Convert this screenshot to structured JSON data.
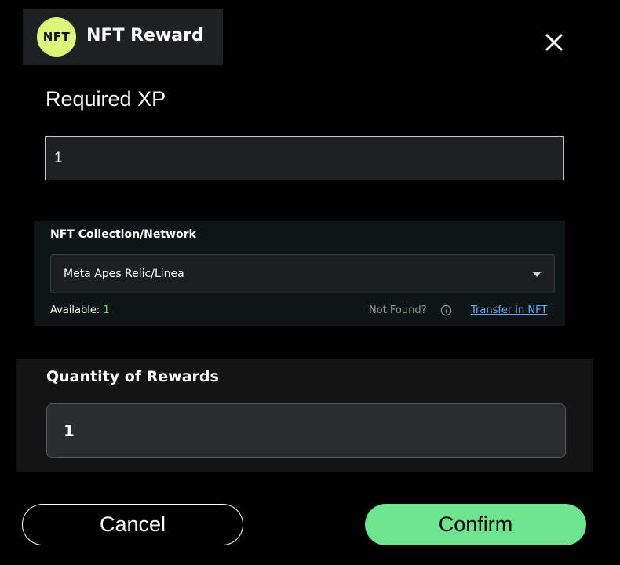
{
  "header": {
    "badge_text": "NFT",
    "title": "NFT Reward",
    "badge_color": "#dcf57a"
  },
  "close_icon": "close-icon",
  "required_xp": {
    "label": "Required XP",
    "value": "1"
  },
  "collection": {
    "label": "NFT Collection/Network",
    "selected": "Meta Apes Relic/Linea",
    "available_label": "Available: ",
    "available_count": "1",
    "not_found_text": "Not Found?",
    "info_icon": "info-icon",
    "transfer_link": "Transfer in NFT"
  },
  "quantity": {
    "label": "Quantity of Rewards",
    "value": "1"
  },
  "actions": {
    "cancel_label": "Cancel",
    "confirm_label": "Confirm",
    "confirm_color": "#6ee390"
  }
}
